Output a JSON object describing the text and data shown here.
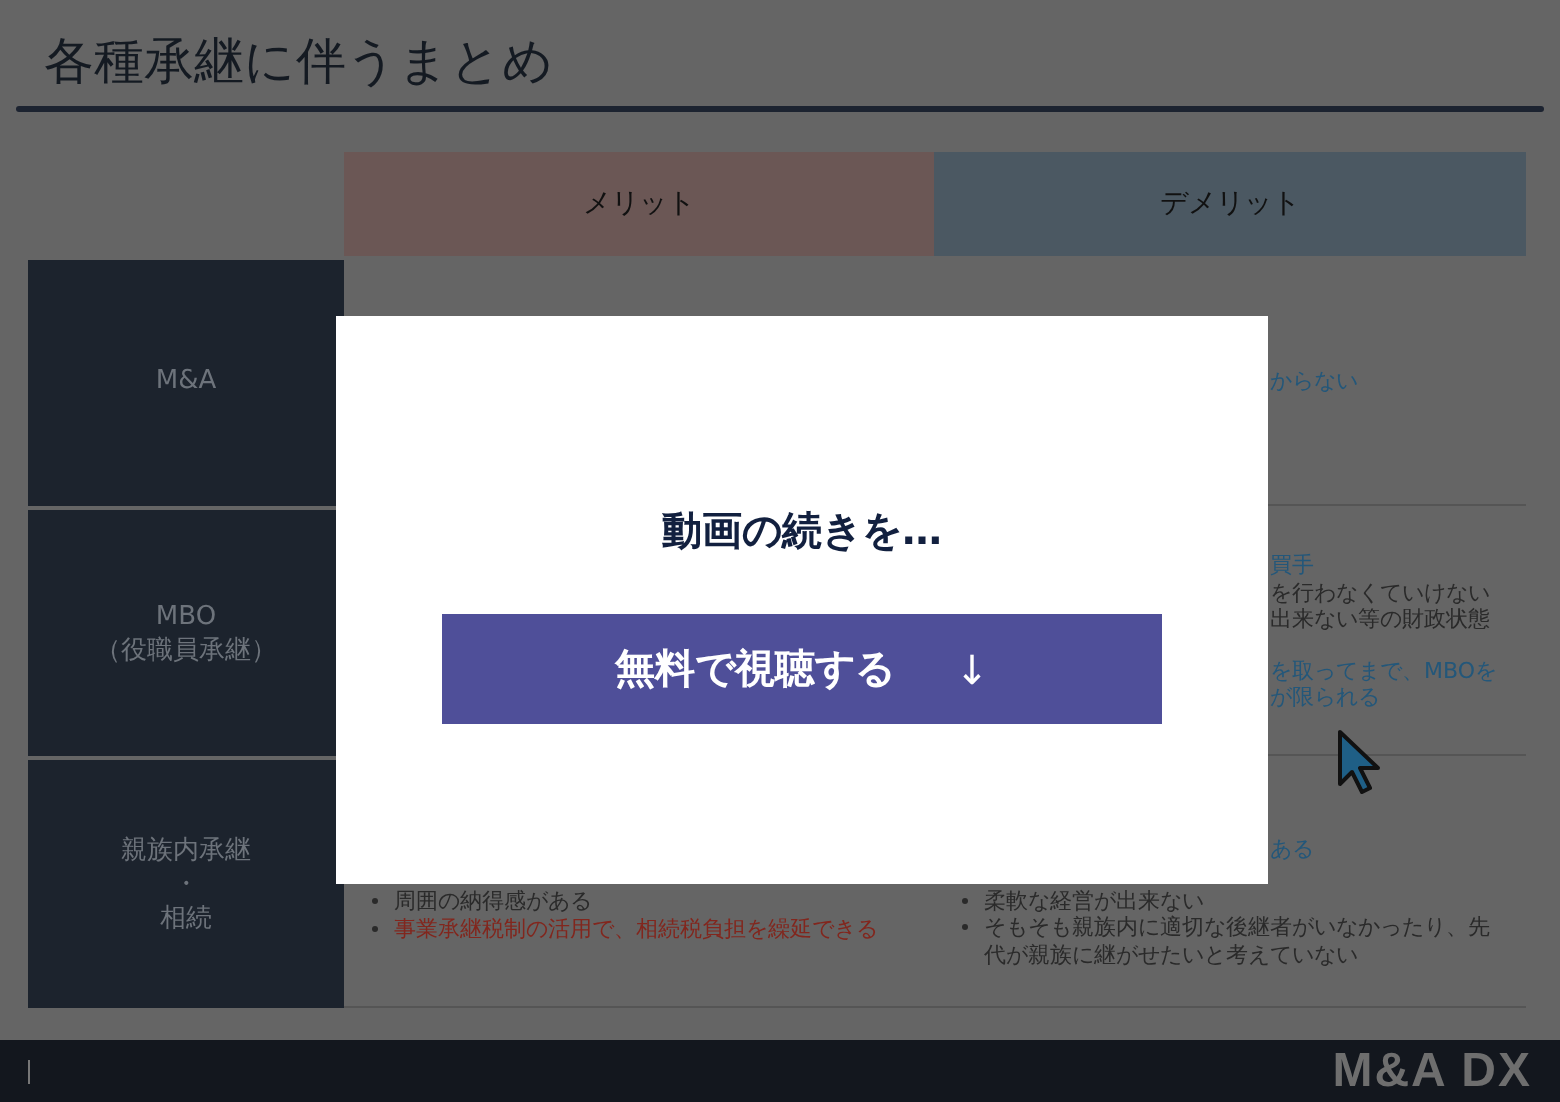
{
  "slide": {
    "title": "各種承継に伴うまとめ",
    "columns": [
      "メリット",
      "デメリット"
    ],
    "rows": [
      {
        "label": [
          "M&A"
        ],
        "cells": [
          {},
          {
            "paragraphs": [
              [
                {
                  "text": "からない",
                  "kind": "fragment",
                  "color": "#23577a"
                }
              ]
            ]
          }
        ]
      },
      {
        "label": [
          "MBO",
          "（役職員承継）"
        ],
        "cells": [
          {},
          {
            "paragraphs": [
              [
                {
                  "text": "買手",
                  "kind": "fragment",
                  "color": "#23577a"
                },
                {
                  "text": "を行わなくていけない",
                  "kind": "fragment",
                  "color": "#2a2a2a"
                },
                {
                  "text": "出来ない等の財政状態",
                  "kind": "fragment",
                  "color": "#2a2a2a"
                }
              ],
              [
                {
                  "text": "を取ってまで、MBOを",
                  "kind": "fragment",
                  "color": "#23577a"
                },
                {
                  "text": "が限られる",
                  "kind": "fragment",
                  "color": "#23577a"
                }
              ]
            ]
          }
        ]
      },
      {
        "label": [
          "親族内承継",
          "・",
          "相続"
        ],
        "cells": [
          {
            "paragraphs": [
              [
                {
                  "text": "周囲の納得感がある",
                  "kind": "bullet",
                  "color": "#2a2a2a"
                },
                {
                  "text": "事業承継税制の活用で、相続税負担を繰延できる",
                  "kind": "bullet",
                  "color": "#82261d"
                }
              ]
            ]
          },
          {
            "paragraphs": [
              [
                {
                  "text": "ある",
                  "kind": "fragment",
                  "color": "#23577a"
                }
              ],
              [
                {
                  "text": "柔軟な経営が出来ない",
                  "kind": "bullet",
                  "color": "#2a2a2a"
                },
                {
                  "text": "そもそも親族内に適切な後継者がいなかったり、先代が親族に継がせたいと考えていない",
                  "kind": "bullet",
                  "color": "#2a2a2a"
                }
              ]
            ]
          }
        ]
      }
    ],
    "logo": "M&A DX"
  },
  "modal": {
    "heading": "動画の続きを…",
    "button": {
      "label": "無料で視聴する",
      "arrow": "↓"
    }
  }
}
